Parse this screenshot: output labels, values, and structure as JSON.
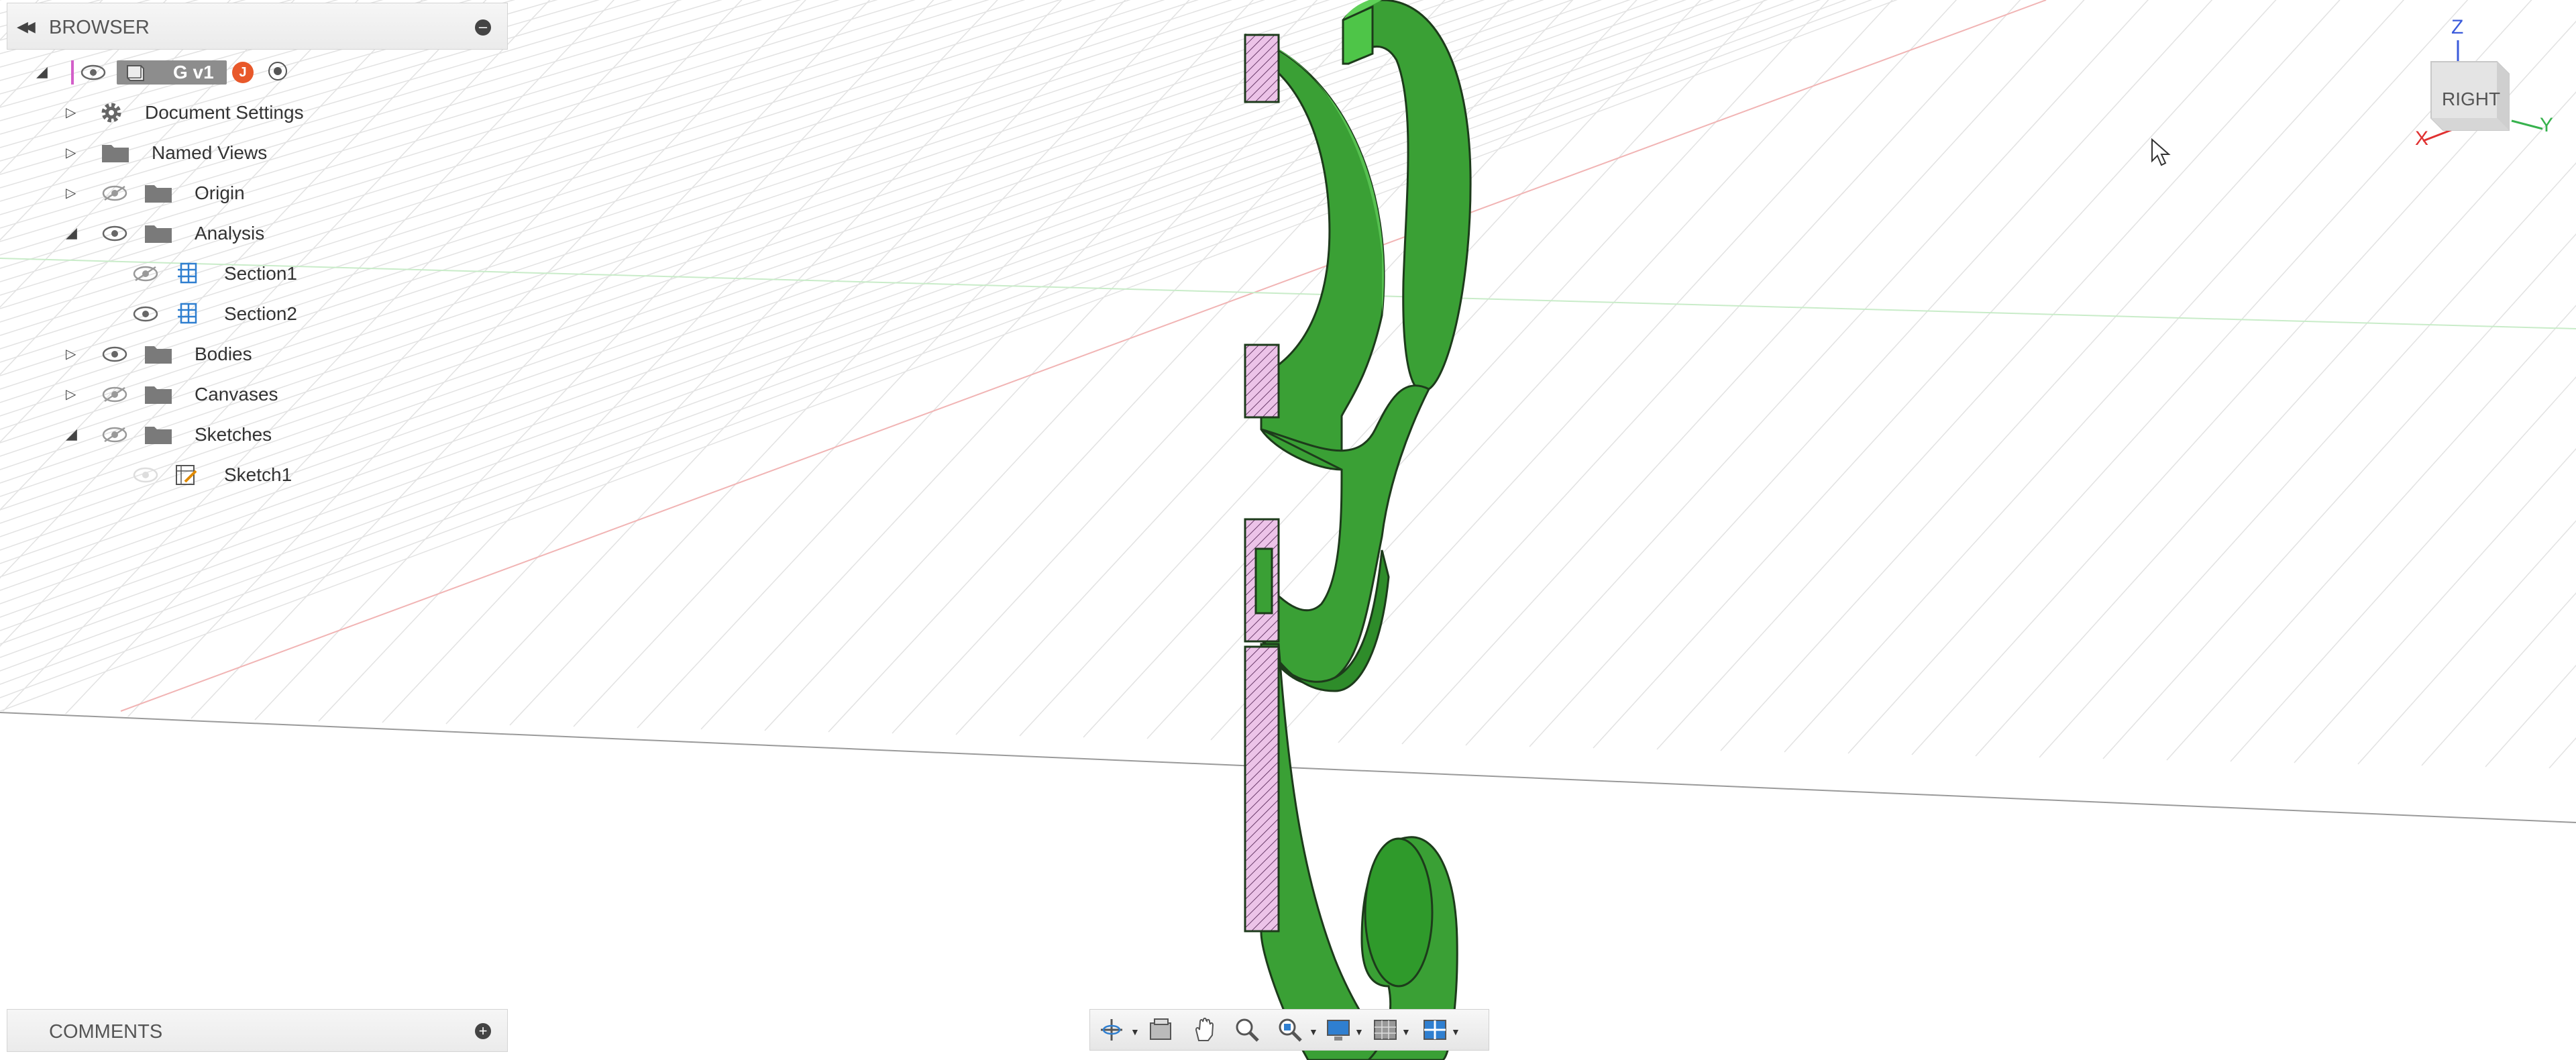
{
  "browser": {
    "title": "BROWSER",
    "collapse_icon": "double-left-arrow",
    "root": {
      "label": "G v1",
      "avatar_letter": "J"
    },
    "items": [
      {
        "label": "Document Settings",
        "icon": "gear-icon",
        "visible": null,
        "expanded": false
      },
      {
        "label": "Named Views",
        "icon": "folder-icon",
        "visible": null,
        "expanded": false
      },
      {
        "label": "Origin",
        "icon": "folder-icon",
        "visible": false,
        "expanded": false
      },
      {
        "label": "Analysis",
        "icon": "folder-icon",
        "visible": true,
        "expanded": true
      },
      {
        "label": "Section1",
        "icon": "section-analysis-icon",
        "visible": false,
        "child": true
      },
      {
        "label": "Section2",
        "icon": "section-analysis-icon",
        "visible": true,
        "child": true
      },
      {
        "label": "Bodies",
        "icon": "folder-icon",
        "visible": true,
        "expanded": false
      },
      {
        "label": "Canvases",
        "icon": "folder-icon",
        "visible": false,
        "expanded": false
      },
      {
        "label": "Sketches",
        "icon": "folder-icon",
        "visible": false,
        "expanded": true
      },
      {
        "label": "Sketch1",
        "icon": "sketch-icon",
        "visible": false,
        "child": true
      }
    ]
  },
  "comments": {
    "title": "COMMENTS"
  },
  "viewcube": {
    "face": "RIGHT",
    "axes": {
      "z": "Z",
      "x": "X",
      "y": "Y"
    },
    "colors": {
      "z": "#3b5bdb",
      "x": "#e03131",
      "y": "#37b24d"
    }
  },
  "toolbar": {
    "tools": [
      "orbit-icon",
      "look-at-icon",
      "pan-icon",
      "zoom-icon",
      "fit-icon",
      "display-settings-icon",
      "grid-settings-icon",
      "viewports-icon"
    ]
  },
  "colors": {
    "model_green": "#3fa63a",
    "model_dark_green": "#2a7f26",
    "section_hatch": "#e8b3e2",
    "grid_line": "#dcdcdc"
  }
}
